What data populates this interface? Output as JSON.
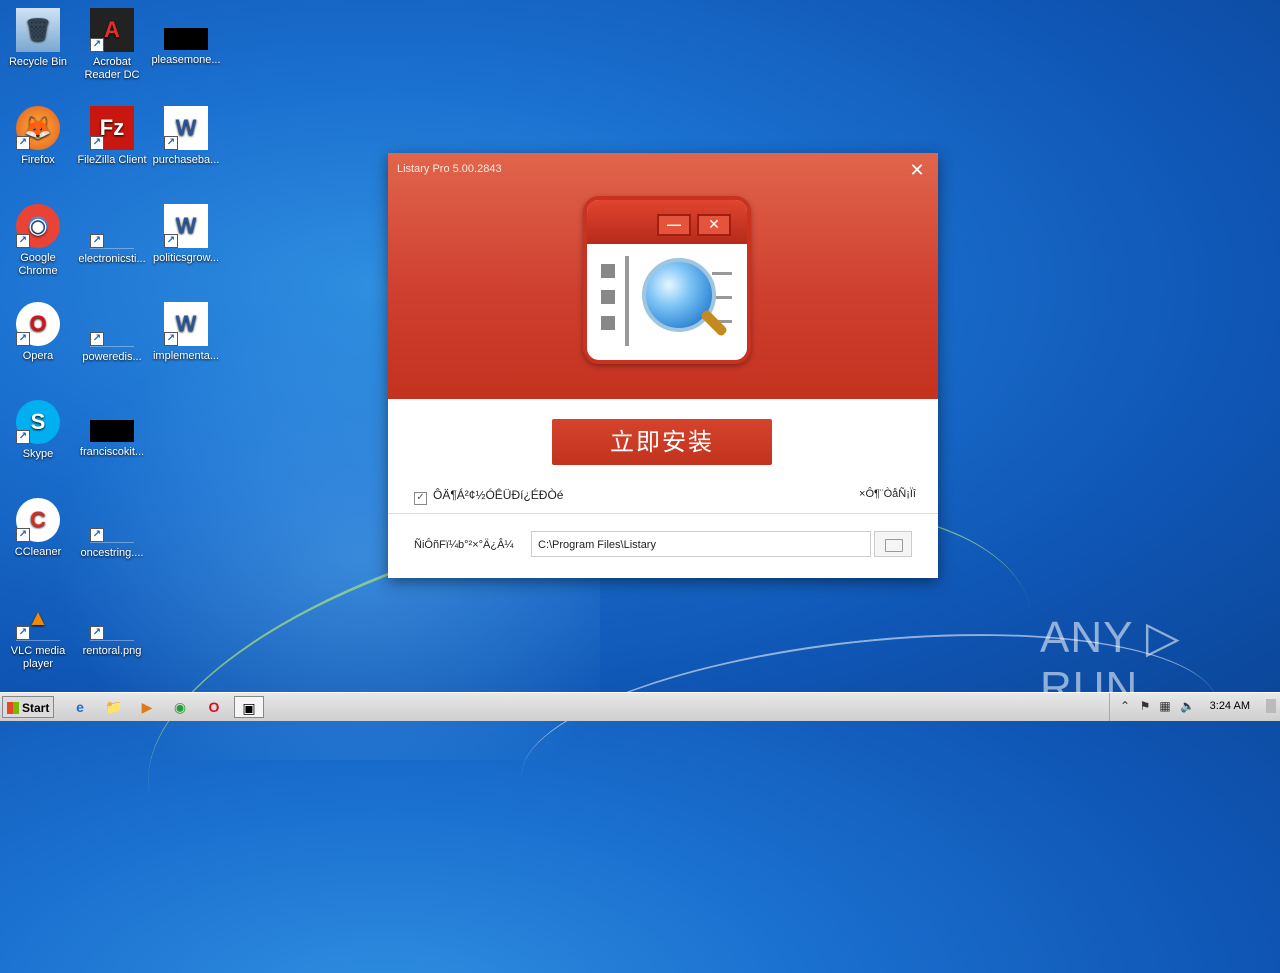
{
  "desktop": {
    "icons": [
      {
        "label": "Recycle Bin",
        "glyph": "🗑"
      },
      {
        "label": "Acrobat Reader DC",
        "glyph": "A"
      },
      {
        "label": "pleasemone...",
        "glyph": ""
      },
      {
        "label": "Firefox",
        "glyph": "🦊"
      },
      {
        "label": "FileZilla Client",
        "glyph": "Fz"
      },
      {
        "label": "purchaseba...",
        "glyph": "W"
      },
      {
        "label": "Google Chrome",
        "glyph": "◉"
      },
      {
        "label": "electronicsti...",
        "glyph": ""
      },
      {
        "label": "politicsgrow...",
        "glyph": "W"
      },
      {
        "label": "Opera",
        "glyph": "O"
      },
      {
        "label": "poweredis...",
        "glyph": ""
      },
      {
        "label": "implementa...",
        "glyph": "W"
      },
      {
        "label": "Skype",
        "glyph": "S"
      },
      {
        "label": "franciscokit...",
        "glyph": ""
      },
      {
        "label": "CCleaner",
        "glyph": "C"
      },
      {
        "label": "oncestring....",
        "glyph": ""
      },
      {
        "label": "VLC media player",
        "glyph": "▲"
      },
      {
        "label": "rentoral.png",
        "glyph": ""
      }
    ]
  },
  "dialog": {
    "title": "Listary Pro 5.00.2843",
    "close_glyph": "✕",
    "install_label": "立即安装",
    "agree_check": "✓",
    "agree_text": "ÔÄ¶Á²¢½ÓÊÜÐí¿ÉÐ­Òé",
    "custom_text": "×Ô¶¨ÒåÑ¡Ïî",
    "path_label": "ÑiÔñFï¼b°²×°Ä¿Â¼",
    "path_value": "C:\\Program Files\\Listary",
    "logo_min": "—",
    "logo_x": "✕"
  },
  "watermark": "ANY ▷ RUN",
  "taskbar": {
    "start_label": "Start",
    "clock": "3:24 AM",
    "tray_up": "⌃",
    "apps": [
      "e",
      "📁",
      "▶",
      "◉",
      "O",
      "▣"
    ]
  }
}
